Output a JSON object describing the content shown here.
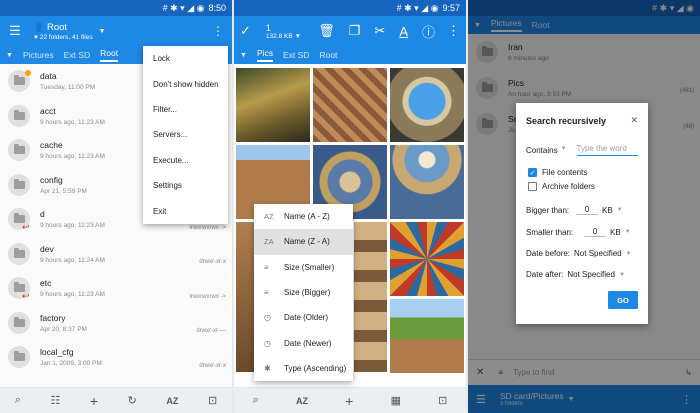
{
  "colors": {
    "primary": "#1e88e5",
    "status": "#1565c0",
    "accent": "#1e88e5",
    "red": "#d32f2f",
    "gold": "#ffa000"
  },
  "p1": {
    "status_time": "8:50",
    "title": "Root",
    "subtitle": "22 folders, 41 files",
    "tabs": [
      "Pictures",
      "Ext SD",
      "Root"
    ],
    "rows": [
      {
        "name": "data",
        "meta": "Tuesday, 11:00 PM",
        "perm": ""
      },
      {
        "name": "acct",
        "meta": "9 hours ago, 11:23 AM",
        "perm": ""
      },
      {
        "name": "cache",
        "meta": "9 hours ago, 11:23 AM",
        "perm": ""
      },
      {
        "name": "config",
        "meta": "Apr 21, 5:59 PM",
        "perm": ""
      },
      {
        "name": "d",
        "meta": "9 hours ago, 11:23 AM",
        "perm": "lrwxrwxrwx ->"
      },
      {
        "name": "dev",
        "meta": "9 hours ago, 11:24 AM",
        "perm": "drwxr-xr-x"
      },
      {
        "name": "etc",
        "meta": "9 hours ago, 11:23 AM",
        "perm": "lrwxrwxrwx ->"
      },
      {
        "name": "factory",
        "meta": "Apr 20, 8:37 PM",
        "perm": "drwxr-xr-—"
      },
      {
        "name": "local_cfg",
        "meta": "Jan 1, 2009, 3:00 PM",
        "perm": "drwxr-xr-x"
      }
    ],
    "menu": [
      "Lock",
      "Don't show hidden",
      "Filter...",
      "Servers...",
      "Execute...",
      "Settings",
      "Exit"
    ],
    "bottom": [
      "search-icon",
      "list-view-icon",
      "add-icon",
      "refresh-icon",
      "AZ",
      "select-all-icon"
    ]
  },
  "p2": {
    "status_time": "9:57",
    "count": "1",
    "size": "132.8 KB",
    "tabs": [
      "Pics",
      "Ext SD",
      "Root"
    ],
    "sort_menu": [
      {
        "icon": "AZ",
        "label": "Name (A - Z)"
      },
      {
        "icon": "ZA",
        "label": "Name (Z - A)"
      },
      {
        "icon": "≡",
        "label": "Size (Smaller)"
      },
      {
        "icon": "≡",
        "label": "Size (Bigger)"
      },
      {
        "icon": "◷",
        "label": "Date (Older)"
      },
      {
        "icon": "◷",
        "label": "Date (Newer)"
      },
      {
        "icon": "✱",
        "label": "Type (Ascending)"
      }
    ],
    "bottom_az": "AZ"
  },
  "p3": {
    "tabs": [
      "Pictures",
      "Root"
    ],
    "rows": [
      {
        "name": "Iran",
        "meta": "8 minutes ago",
        "count": ""
      },
      {
        "name": "Pics",
        "meta": "An hour ago, 9:53 PM",
        "count": "(481)"
      },
      {
        "name": "Sc",
        "meta": "Ju",
        "count": "(48)"
      }
    ],
    "dialog": {
      "title": "Search recursively",
      "mode": "Contains",
      "placeholder": "Type the word",
      "opt1": "File contents",
      "opt2": "Archive folders",
      "bigger_label": "Bigger than:",
      "bigger_val": "0",
      "bigger_unit": "KB",
      "smaller_label": "Smaller than:",
      "smaller_val": "0",
      "smaller_unit": "KB",
      "date_before_label": "Date before:",
      "date_before_val": "Not Specified",
      "date_after_label": "Date after:",
      "date_after_val": "Not Specified",
      "go": "GO"
    },
    "find_placeholder": "Type to find",
    "path": "SD card/Pictures",
    "path_sub": "3 folders"
  }
}
